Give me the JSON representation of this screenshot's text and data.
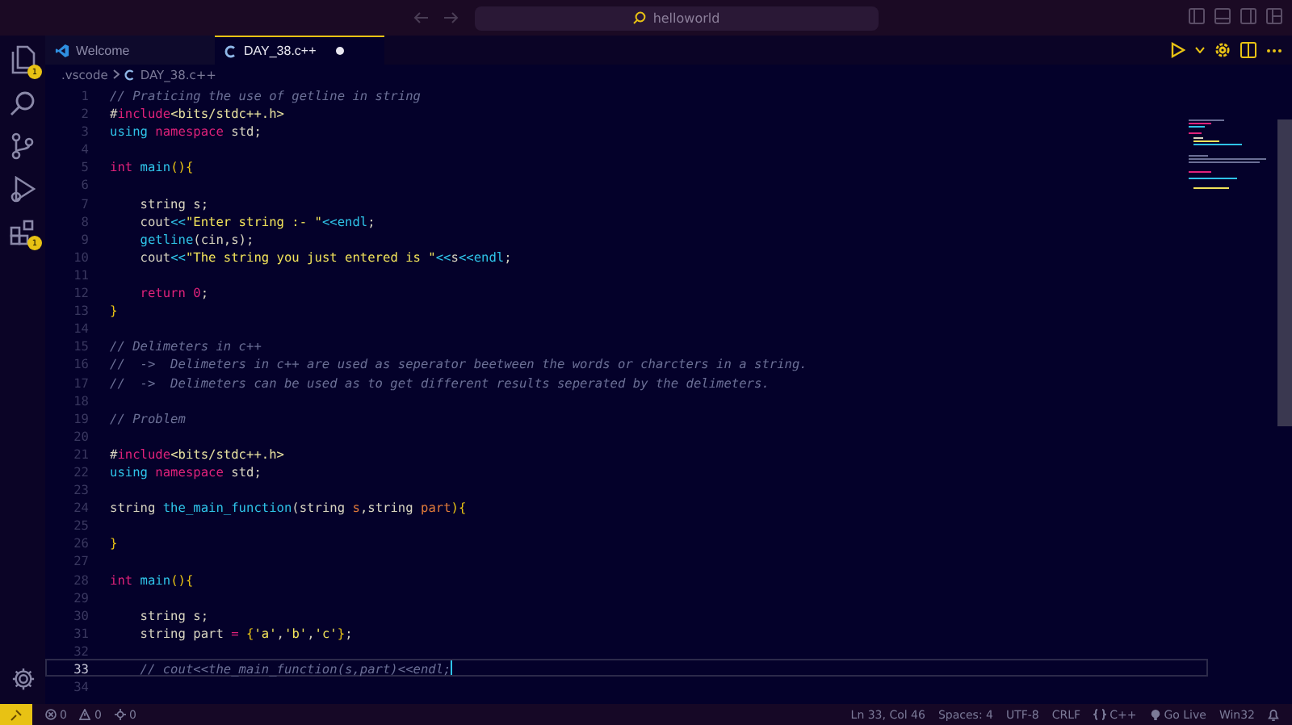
{
  "title_bar": {
    "search": "helloworld"
  },
  "activity_bar": [
    {
      "kind": "files",
      "badge": "1"
    },
    {
      "kind": "search"
    },
    {
      "kind": "branch"
    },
    {
      "kind": "run"
    },
    {
      "kind": "extensions",
      "badge": "1"
    }
  ],
  "tabs": [
    {
      "kind": "vscode",
      "label": "Welcome",
      "selected": false,
      "modified": false
    },
    {
      "kind": "cpp",
      "label": "DAY_38.c++",
      "selected": true,
      "modified": true
    }
  ],
  "breadcrumb": [
    ".vscode",
    "DAY_38.c++"
  ],
  "editor": {
    "lines": [
      {
        "number": "1",
        "current": false,
        "tokens": [
          {
            "kind": "cm",
            "text": "// Praticing the use of getline in string"
          }
        ]
      },
      {
        "number": "2",
        "current": false,
        "tokens": [
          {
            "kind": "pl",
            "text": "#"
          },
          {
            "kind": "kw",
            "text": "include"
          },
          {
            "kind": "inc",
            "text": "<bits/stdc++.h>"
          }
        ]
      },
      {
        "number": "3",
        "current": false,
        "tokens": [
          {
            "kind": "fn",
            "text": "using "
          },
          {
            "kind": "kw",
            "text": "namespace "
          },
          {
            "kind": "pl",
            "text": "std;"
          }
        ]
      },
      {
        "number": "4",
        "current": false
      },
      {
        "number": "5",
        "current": false,
        "tokens": [
          {
            "kind": "kw",
            "text": "int "
          },
          {
            "kind": "fn",
            "text": "main"
          },
          {
            "kind": "br",
            "text": "(){"
          }
        ]
      },
      {
        "number": "6",
        "current": false
      },
      {
        "number": "7",
        "current": false,
        "tokens": [
          {
            "kind": "pl",
            "text": "    string s;"
          }
        ]
      },
      {
        "number": "8",
        "current": false,
        "tokens": [
          {
            "kind": "pl",
            "text": "    cout"
          },
          {
            "kind": "fn",
            "text": "<<"
          },
          {
            "kind": "str",
            "text": "\"Enter string :- \""
          },
          {
            "kind": "fn",
            "text": "<<endl"
          },
          {
            "kind": "pl",
            "text": ";"
          }
        ]
      },
      {
        "number": "9",
        "current": false,
        "tokens": [
          {
            "kind": "fn",
            "text": "    getline"
          },
          {
            "kind": "pl",
            "text": "(cin,s);"
          }
        ]
      },
      {
        "number": "10",
        "current": false,
        "tokens": [
          {
            "kind": "pl",
            "text": "    cout"
          },
          {
            "kind": "fn",
            "text": "<<"
          },
          {
            "kind": "str",
            "text": "\"The string you just entered is \""
          },
          {
            "kind": "fn",
            "text": "<<"
          },
          {
            "kind": "pl",
            "text": "s"
          },
          {
            "kind": "fn",
            "text": "<<endl"
          },
          {
            "kind": "pl",
            "text": ";"
          }
        ]
      },
      {
        "number": "11",
        "current": false
      },
      {
        "number": "12",
        "current": false,
        "tokens": [
          {
            "kind": "kw",
            "text": "    return "
          },
          {
            "kind": "num",
            "text": "0"
          },
          {
            "kind": "pl",
            "text": ";"
          }
        ]
      },
      {
        "number": "13",
        "current": false,
        "tokens": [
          {
            "kind": "br",
            "text": "}"
          }
        ]
      },
      {
        "number": "14",
        "current": false
      },
      {
        "number": "15",
        "current": false,
        "tokens": [
          {
            "kind": "cm",
            "text": "// Delimeters in c++"
          }
        ]
      },
      {
        "number": "16",
        "current": false,
        "tokens": [
          {
            "kind": "cm",
            "text": "//  ->  Delimeters in c++ are used as seperator beetween the words or charcters in a string."
          }
        ]
      },
      {
        "number": "17",
        "current": false,
        "tokens": [
          {
            "kind": "cm",
            "text": "//  ->  Delimeters can be used as to get different results seperated by the delimeters."
          }
        ]
      },
      {
        "number": "18",
        "current": false
      },
      {
        "number": "19",
        "current": false,
        "tokens": [
          {
            "kind": "cm",
            "text": "// Problem"
          }
        ]
      },
      {
        "number": "20",
        "current": false
      },
      {
        "number": "21",
        "current": false,
        "tokens": [
          {
            "kind": "pl",
            "text": "#"
          },
          {
            "kind": "kw",
            "text": "include"
          },
          {
            "kind": "inc",
            "text": "<bits/stdc++.h>"
          }
        ]
      },
      {
        "number": "22",
        "current": false,
        "tokens": [
          {
            "kind": "fn",
            "text": "using "
          },
          {
            "kind": "kw",
            "text": "namespace "
          },
          {
            "kind": "pl",
            "text": "std;"
          }
        ]
      },
      {
        "number": "23",
        "current": false
      },
      {
        "number": "24",
        "current": false,
        "tokens": [
          {
            "kind": "pl",
            "text": "string "
          },
          {
            "kind": "fn",
            "text": "the_main_function"
          },
          {
            "kind": "pl",
            "text": "(string "
          },
          {
            "kind": "par",
            "text": "s"
          },
          {
            "kind": "pl",
            "text": ",string "
          },
          {
            "kind": "par",
            "text": "part"
          },
          {
            "kind": "br",
            "text": "){"
          }
        ]
      },
      {
        "number": "25",
        "current": false
      },
      {
        "number": "26",
        "current": false,
        "tokens": [
          {
            "kind": "br",
            "text": "}"
          }
        ]
      },
      {
        "number": "27",
        "current": false
      },
      {
        "number": "28",
        "current": false,
        "tokens": [
          {
            "kind": "kw",
            "text": "int "
          },
          {
            "kind": "fn",
            "text": "main"
          },
          {
            "kind": "br",
            "text": "(){"
          }
        ]
      },
      {
        "number": "29",
        "current": false
      },
      {
        "number": "30",
        "current": false,
        "tokens": [
          {
            "kind": "pl",
            "text": "    string s;"
          }
        ]
      },
      {
        "number": "31",
        "current": false,
        "tokens": [
          {
            "kind": "pl",
            "text": "    string part "
          },
          {
            "kind": "kw",
            "text": "= "
          },
          {
            "kind": "br",
            "text": "{"
          },
          {
            "kind": "str",
            "text": "'a'"
          },
          {
            "kind": "pl",
            "text": ","
          },
          {
            "kind": "str",
            "text": "'b'"
          },
          {
            "kind": "pl",
            "text": ","
          },
          {
            "kind": "str",
            "text": "'c'"
          },
          {
            "kind": "br",
            "text": "}"
          },
          {
            "kind": "pl",
            "text": ";"
          }
        ]
      },
      {
        "number": "32",
        "current": false
      },
      {
        "number": "33",
        "current": true,
        "tokens": [
          {
            "kind": "cm",
            "text": "    // cout<<the_main_function(s,part)<<endl;"
          }
        ]
      },
      {
        "number": "34",
        "current": false
      }
    ]
  },
  "status_bar": {
    "left": [
      {
        "kind": "error",
        "text": "0"
      },
      {
        "kind": "warning",
        "text": "0"
      },
      {
        "kind": "ports",
        "text": "0"
      }
    ],
    "right": [
      {
        "kind": "text",
        "text": "Ln 33, Col 46"
      },
      {
        "kind": "text",
        "text": "Spaces: 4"
      },
      {
        "kind": "text",
        "text": "UTF-8"
      },
      {
        "kind": "text",
        "text": "CRLF"
      },
      {
        "kind": "braces",
        "text": "C++"
      },
      {
        "kind": "live",
        "text": "Go Live"
      },
      {
        "kind": "text",
        "text": "Win32"
      },
      {
        "kind": "bell"
      }
    ]
  }
}
